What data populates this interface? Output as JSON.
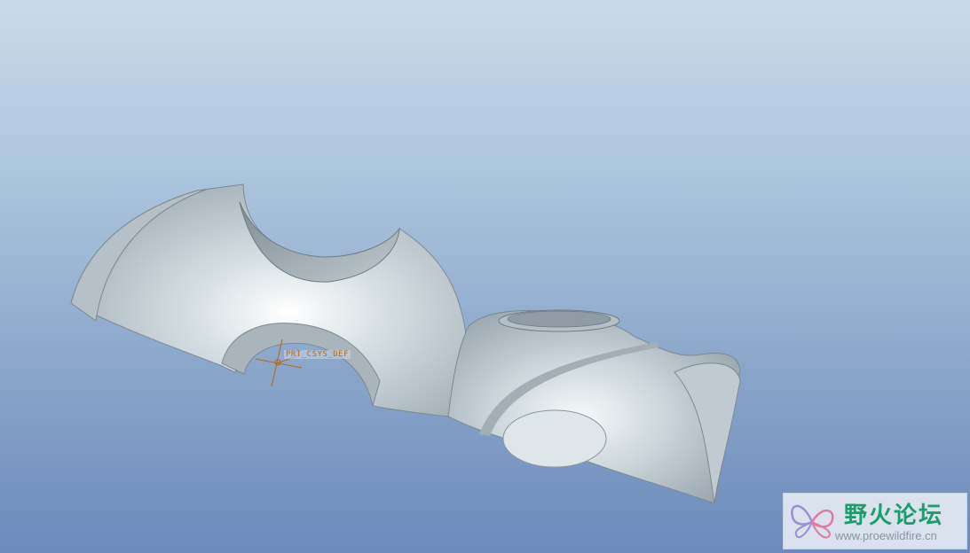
{
  "viewport": {
    "csys_label": "PRT_CSYS_DEF"
  },
  "watermark": {
    "title": "野火论坛",
    "url": "www.proewildfire.cn",
    "logo_icon": "butterfly-logo-icon"
  },
  "colors": {
    "background_top": "#c9dbea",
    "background_bottom": "#6b8bbb",
    "model_surface": "#c8d3d8",
    "csys_color": "#b06a1c",
    "watermark_text": "#1c9e6a"
  }
}
